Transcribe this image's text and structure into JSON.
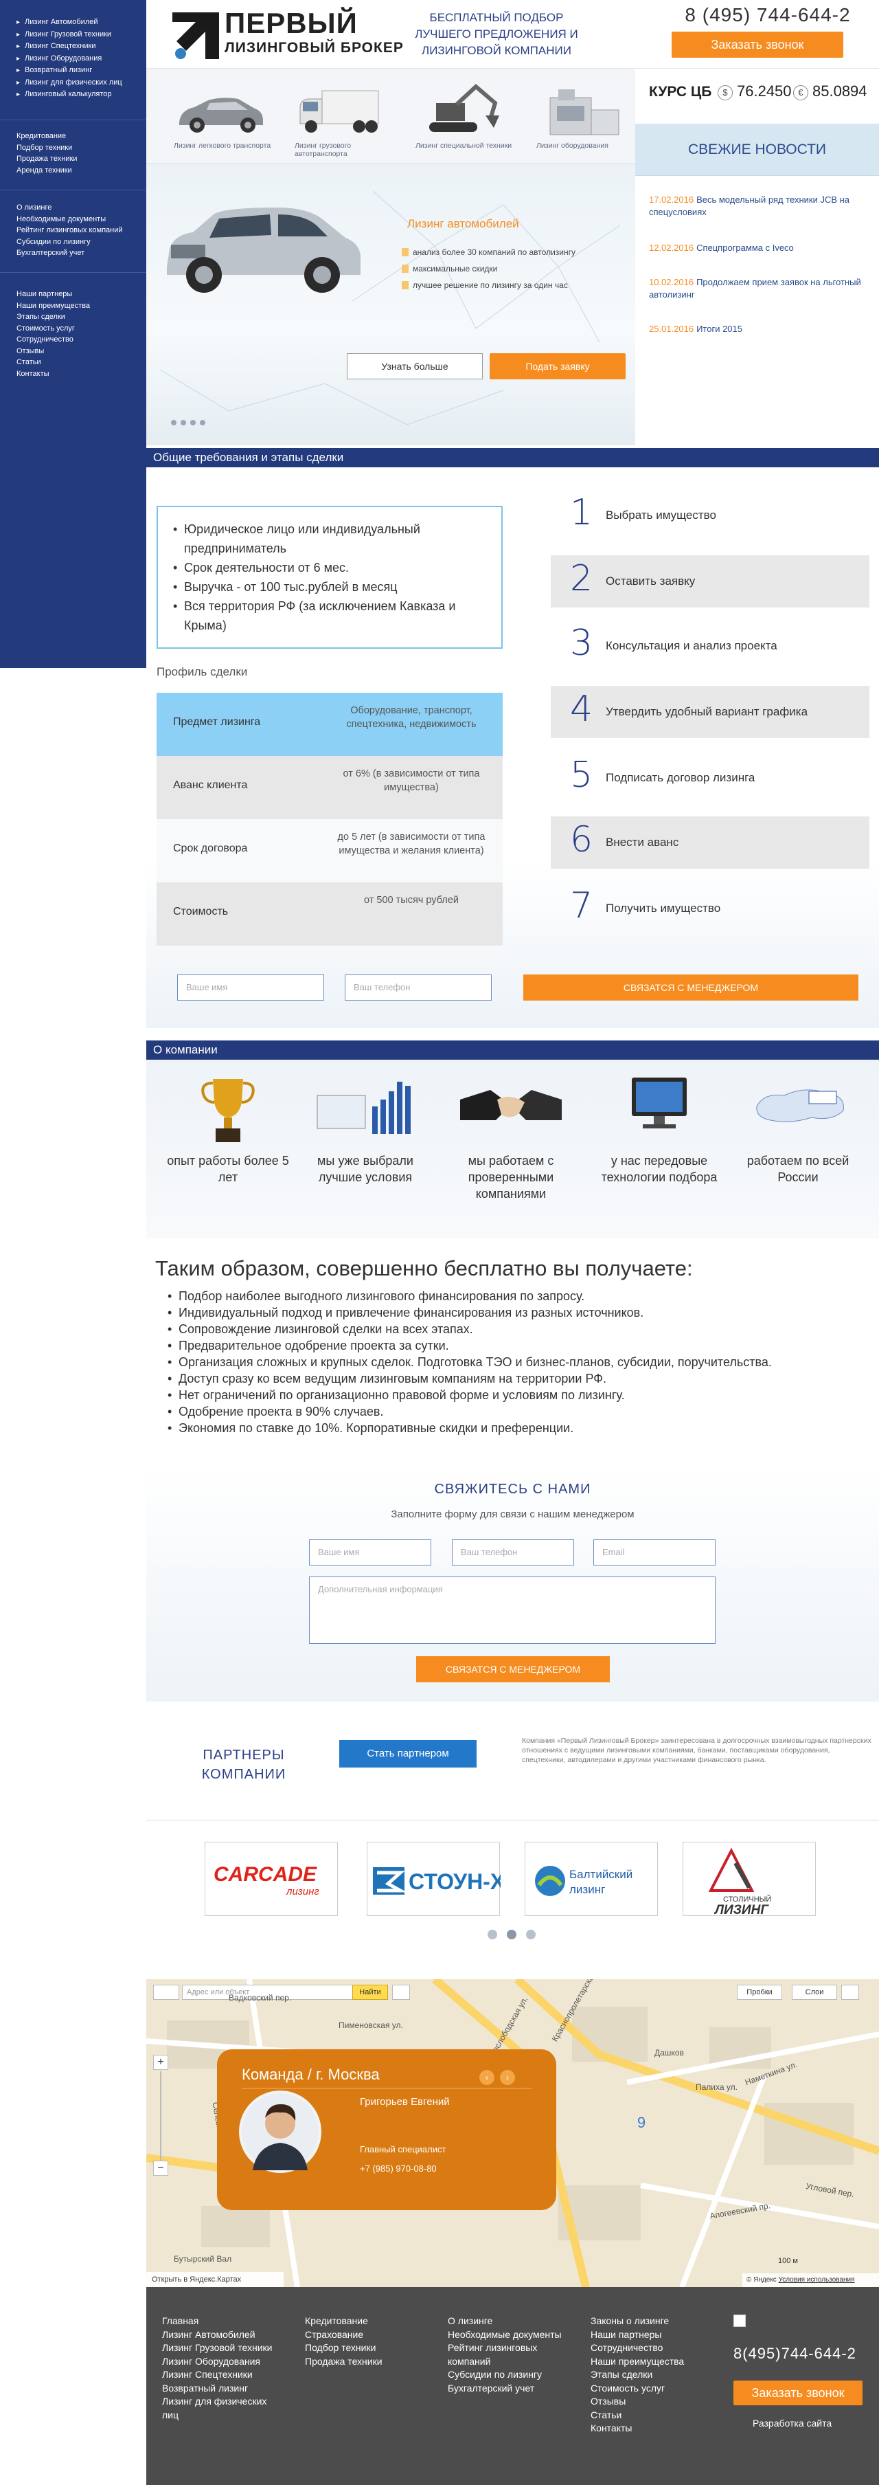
{
  "sidebar": {
    "group1": [
      "Лизинг Автомобилей",
      "Лизинг Грузовой техники",
      "Лизинг Спецтехники",
      "Лизинг Оборудования",
      "Возвратный лизинг",
      "Лизинг для физических лиц",
      "Лизинговый калькулятор"
    ],
    "group2": [
      "Кредитование",
      "Подбор техники",
      "Продажа техники",
      "Аренда техники"
    ],
    "group3": [
      "О лизинге",
      "Необходимые документы",
      "Рейтинг лизинговых компаний",
      "Субсидии по лизингу",
      "Бухгалтерский учет"
    ],
    "group4": [
      "Наши партнеры",
      "Наши преимущества",
      "Этапы сделки",
      "Стоимость услуг",
      "Сотрудничество",
      "Отзывы",
      "Статьи",
      "Контакты"
    ]
  },
  "header": {
    "logo_line1": "ПЕРВЫЙ",
    "logo_line2": "ЛИЗИНГОВЫЙ БРОКЕР",
    "tagline": "БЕСПЛАТНЫЙ ПОДБОР ЛУЧШЕГО ПРЕДЛОЖЕНИЯ И ЛИЗИНГОВОЙ КОМПАНИИ",
    "phone": "8 (495) 744-644-2",
    "callback_button": "Заказать звонок"
  },
  "categories": [
    "Лизинг легкового транспорта",
    "Лизинг грузового автотранспорта",
    "Лизинг специальной техники",
    "Лизинг оборудования"
  ],
  "rate": {
    "label": "КУРС ЦБ",
    "usd_symbol": "$",
    "usd": "76.2450",
    "eur_symbol": "€",
    "eur": "85.0894"
  },
  "news": {
    "title": "СВЕЖИЕ НОВОСТИ",
    "items": [
      {
        "date": "17.02.2016",
        "text": "Весь модельный ряд техники JCB на спецусловиях"
      },
      {
        "date": "12.02.2016",
        "text": "Спецпрограмма с Iveco"
      },
      {
        "date": "10.02.2016",
        "text": "Продолжаем прием заявок на льготный автолизинг"
      },
      {
        "date": "25.01.2016",
        "text": "Итоги 2015"
      }
    ]
  },
  "hero": {
    "title": "Лизинг автомобилей",
    "bullets": [
      "анализ более 30 компаний по автолизингу",
      "максимальные скидки",
      "лучшее решение по лизингу за один час"
    ],
    "more_button": "Узнать больше",
    "apply_button": "Подать заявку"
  },
  "requirements": {
    "section_title": "Общие требования и этапы сделки",
    "items": [
      "Юридическое лицо или индивидуальный предприниматель",
      "Срок деятельности от 6 мес.",
      "Выручка - от 100 тыс.рублей в месяц",
      "Вся территория РФ (за исключением Кавказа и Крыма)"
    ],
    "profile_title": "Профиль сделки",
    "profile": [
      {
        "name": "Предмет лизинга",
        "value": "Оборудование, транспорт, спецтехника, недвижимость"
      },
      {
        "name": "Аванс клиента",
        "value": "от 6% (в зависимости от типа имущества)"
      },
      {
        "name": "Срок договора",
        "value": "до 5 лет (в зависимости от типа имущества и желания клиента)"
      },
      {
        "name": "Стоимость",
        "value": "от 500 тысяч рублей"
      }
    ],
    "steps": [
      {
        "num": "1",
        "text": "Выбрать имущество"
      },
      {
        "num": "2",
        "text": "Оставить заявку"
      },
      {
        "num": "3",
        "text": "Консультация и анализ проекта"
      },
      {
        "num": "4",
        "text": "Утвердить удобный вариант графика"
      },
      {
        "num": "5",
        "text": "Подписать договор лизинга"
      },
      {
        "num": "6",
        "text": "Внести аванс"
      },
      {
        "num": "7",
        "text": "Получить имущество"
      }
    ],
    "name_placeholder": "Ваше имя",
    "phone_placeholder": "Ваш телефон",
    "submit": "СВЯЗАТСЯ С МЕНЕДЖЕРОМ"
  },
  "about": {
    "section_title": "О компании",
    "features": [
      "опыт работы более 5 лет",
      "мы уже выбрали лучшие условия",
      "мы работаем с проверенными компаниями",
      "у нас передовые технологии подбора",
      "работаем по всей России"
    ],
    "benefits_title": "Таким образом, совершенно бесплатно вы получаете:",
    "benefits": [
      "Подбор наиболее выгодного лизингового финансирования по запросу.",
      "Индивидуальный подход и привлечение финансирования из разных источников.",
      "Сопровождение лизинговой сделки на всех этапах.",
      "Предварительное одобрение проекта за сутки.",
      "Организация сложных и крупных сделок. Подготовка ТЭО и бизнес-планов, субсидии, поручительства.",
      "Доступ сразу ко всем ведущим лизинговым компаниям на территории РФ.",
      "Нет ограничений по организационно правовой форме и условиям по лизингу.",
      "Одобрение проекта в 90% случаев.",
      "Экономия по ставке до 10%. Корпоративные скидки и преференции."
    ]
  },
  "contact": {
    "title": "СВЯЖИТЕСЬ С НАМИ",
    "subtitle": "Заполните форму для связи с нашим менеджером",
    "name_placeholder": "Ваше имя",
    "phone_placeholder": "Ваш телефон",
    "email_placeholder": "Email",
    "info_placeholder": "Дополнительная информация",
    "submit": "СВЯЗАТСЯ С МЕНЕДЖЕРОМ"
  },
  "partners": {
    "title": "ПАРТНЕРЫ КОМПАНИИ",
    "button": "Стать партнером",
    "text": "Компания «Первый Лизинговый Брокер» заинтересована в долгосрочных взаимовыгодных партнерских отношениях с ведущими лизинговыми компаниями, банками, поставщиками оборудования, спецтехники, автодилерами и другими участниками финансового рынка.",
    "logos": [
      "CARCADE лизинг",
      "СТОУН-XXI",
      "Балтийский лизинг",
      "Столичный лизинг"
    ]
  },
  "map": {
    "search_placeholder": "Адрес или объект",
    "find_button": "Найти",
    "traffic_button": "Пробки",
    "layers_button": "Слои",
    "open_link": "Открыть в Яндекс.Картах",
    "copyright": "© Яндекс",
    "terms": "Условия использования",
    "streets": [
      "Новослободская ул.",
      "Селезнёвская ул.",
      "Краснопролетарская ул.",
      "Палиха ул.",
      "Наметкина ул.",
      "Пименовская ул.",
      "Вадковский пер.",
      "Угловой пер.",
      "Бутырский Вал",
      "Дашков",
      "Апогеевский пр."
    ],
    "scale": "100 м"
  },
  "team_card": {
    "title": "Команда / г. Москва",
    "name": "Григорьев Евгений",
    "position": "Главный специалист",
    "phone": "+7 (985) 970-08-80"
  },
  "footer": {
    "col1": [
      "Главная",
      "Лизинг Автомобилей",
      "Лизинг Грузовой техники",
      "Лизинг Оборудования",
      "Лизинг Спецтехники",
      "Возвратный лизинг",
      "Лизинг для физических лиц"
    ],
    "col2": [
      "Кредитование",
      "Страхование",
      "Подбор техники",
      "Продажа техники"
    ],
    "col3": [
      "О лизинге",
      "Необходимые документы",
      "Рейтинг лизинговых компаний",
      "Субсидии по лизингу",
      "Бухгалтерский учет"
    ],
    "col4": [
      "Законы о лизинге",
      "Наши партнеры",
      "Сотрудничество",
      "Наши преимущества",
      "Этапы сделки",
      "Стоимость услуг",
      "Отзывы",
      "Статьи",
      "Контакты"
    ],
    "phone": "8(495)744-644-2",
    "callback_button": "Заказать звонок",
    "dev": "Разработка сайта"
  }
}
